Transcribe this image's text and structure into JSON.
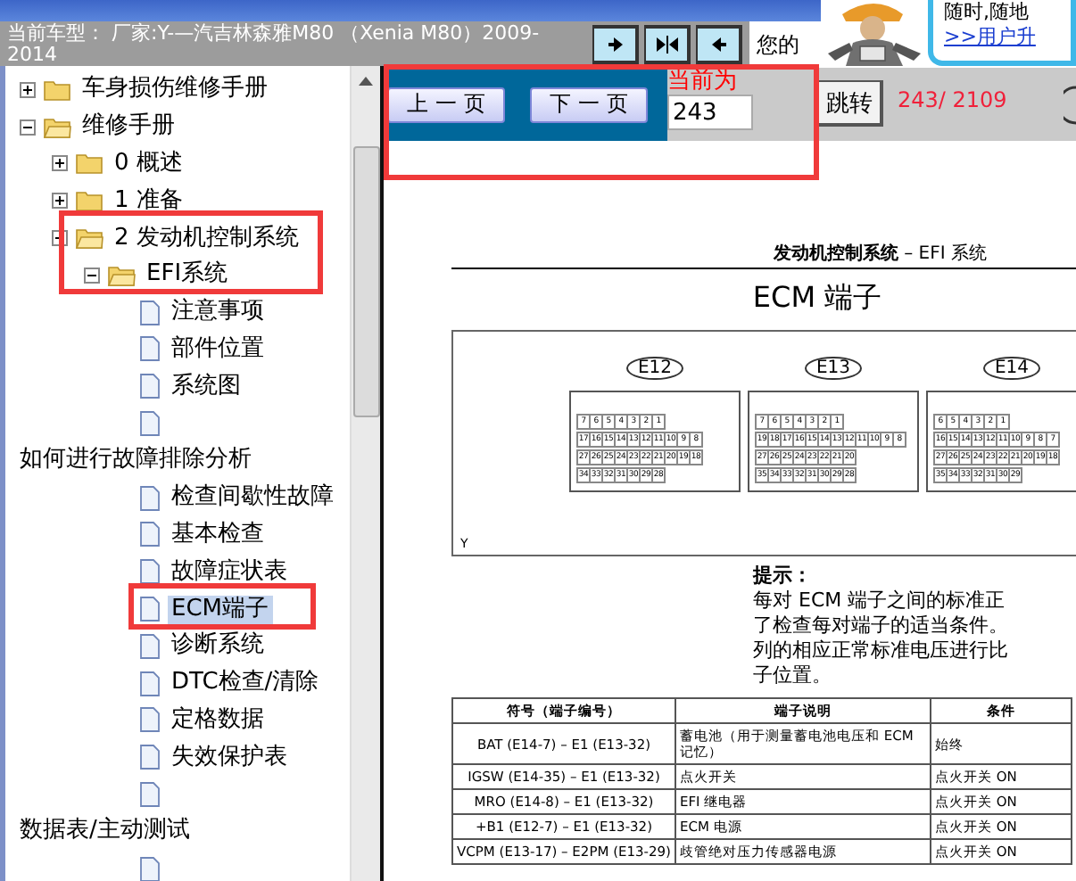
{
  "header": {
    "car_model": "当前车型： 厂家:Y-—汽吉林森雅M80 （Xenia M80）2009-2014",
    "nav_buttons": [
      {
        "kind": "forward"
      },
      {
        "kind": "split"
      },
      {
        "kind": "back"
      }
    ],
    "notice": "您的",
    "ad": {
      "text": "随时,随地",
      "link": ">>用户升"
    }
  },
  "tree": [
    {
      "kind": "folder",
      "label": "车身损伤维修手册",
      "expanded": false,
      "selected": false
    },
    {
      "kind": "folder",
      "label": "维修手册",
      "expanded": true,
      "selected": false,
      "children": [
        {
          "kind": "folder",
          "label": "0 概述",
          "expanded": false,
          "selected": false
        },
        {
          "kind": "folder",
          "label": "1 准备",
          "expanded": false,
          "selected": false
        },
        {
          "kind": "folder",
          "label": "2 发动机控制系统",
          "expanded": true,
          "selected": false,
          "children": [
            {
              "kind": "folder",
              "label": "EFI系统",
              "expanded": true,
              "selected": false,
              "children": [
                {
                  "kind": "doc",
                  "label": "注意事项",
                  "selected": false
                },
                {
                  "kind": "doc",
                  "label": "部件位置",
                  "selected": false
                },
                {
                  "kind": "doc",
                  "label": "系统图",
                  "selected": false
                },
                {
                  "kind": "doc",
                  "selected": false
                },
                {
                  "kind": "note",
                  "label": "如何进行故障排除分析",
                  "selected": false
                },
                {
                  "kind": "doc",
                  "label": "检查间歇性故障",
                  "selected": false
                },
                {
                  "kind": "doc",
                  "label": "基本检查",
                  "selected": false
                },
                {
                  "kind": "doc",
                  "label": "故障症状表",
                  "selected": false
                },
                {
                  "kind": "doc",
                  "label": "ECM端子",
                  "selected": true
                },
                {
                  "kind": "doc",
                  "label": "诊断系统",
                  "selected": false
                },
                {
                  "kind": "doc",
                  "label": "DTC检查/清除",
                  "selected": false
                },
                {
                  "kind": "doc",
                  "label": "定格数据",
                  "selected": false
                },
                {
                  "kind": "doc",
                  "label": "失效保护表",
                  "selected": false
                },
                {
                  "kind": "doc",
                  "selected": false
                },
                {
                  "kind": "note",
                  "label": "数据表/主动测试",
                  "selected": false
                },
                {
                  "kind": "doc",
                  "selected": false
                }
              ]
            }
          ]
        }
      ]
    }
  ],
  "toolbar": {
    "prev": "上 一 页",
    "next": "下 一 页",
    "page_label": "当前为",
    "page_input": "243",
    "go": "跳转",
    "page_count": "243/ 2109"
  },
  "document": {
    "header": "**发动机控制系统** – EFI 系统",
    "title": "ECM 端子",
    "connectors": [
      {
        "label": "E12",
        "rows": [
          [
            "7",
            "6",
            "5",
            "4",
            "3",
            "2",
            "1"
          ],
          [
            "17",
            "16",
            "15",
            "14",
            "13",
            "12",
            "11",
            "10",
            "9",
            "8"
          ],
          [
            "27",
            "26",
            "25",
            "24",
            "23",
            "22",
            "21",
            "20",
            "19",
            "18"
          ],
          [
            "34",
            "33",
            "32",
            "31",
            "30",
            "29",
            "28"
          ]
        ]
      },
      {
        "label": "E13",
        "rows": [
          [
            "7",
            "6",
            "5",
            "4",
            "3",
            "2",
            "1"
          ],
          [
            "19",
            "18",
            "17",
            "16",
            "15",
            "14",
            "13",
            "12",
            "11",
            "10",
            "9",
            "8"
          ],
          [
            "27",
            "26",
            "25",
            "24",
            "23",
            "22",
            "21",
            "20"
          ],
          [
            "35",
            "34",
            "33",
            "32",
            "31",
            "30",
            "29",
            "28"
          ]
        ]
      },
      {
        "label": "E14",
        "rows": [
          [
            "6",
            "5",
            "4",
            "3",
            "2",
            "1"
          ],
          [
            "16",
            "15",
            "14",
            "13",
            "12",
            "11",
            "10",
            "9",
            "8",
            "7"
          ],
          [
            "27",
            "26",
            "25",
            "24",
            "23",
            "22",
            "21",
            "20",
            "19",
            "18"
          ],
          [
            "35",
            "34",
            "33",
            "32",
            "31",
            "30",
            "29"
          ]
        ]
      }
    ],
    "diagram_mark": "Y",
    "hint_title": "提示：",
    "hint_lines": [
      "每对 ECM 端子之间的标准正",
      "了检查每对端子的适当条件。",
      "列的相应正常标准电压进行比",
      "子位置。"
    ],
    "table": {
      "columns": [
        "符号（端子编号）",
        "端子说明",
        "条件"
      ],
      "rows": [
        [
          "BAT (E14-7) – E1 (E13-32)",
          "蓄电池（用于测量蓄电池电压和 ECM 记忆）",
          "始终"
        ],
        [
          "IGSW (E14-35) – E1 (E13-32)",
          "点火开关",
          "点火开关 ON"
        ],
        [
          "MRO (E14-8) – E1 (E13-32)",
          "EFI 继电器",
          "点火开关 ON"
        ],
        [
          "+B1 (E12-7) – E1 (E13-32)",
          "ECM 电源",
          "点火开关 ON"
        ],
        [
          "VCPM (E13-17) – E2PM (E13-29)",
          "歧管绝对压力传感器电源",
          "点火开关 ON"
        ]
      ]
    }
  }
}
